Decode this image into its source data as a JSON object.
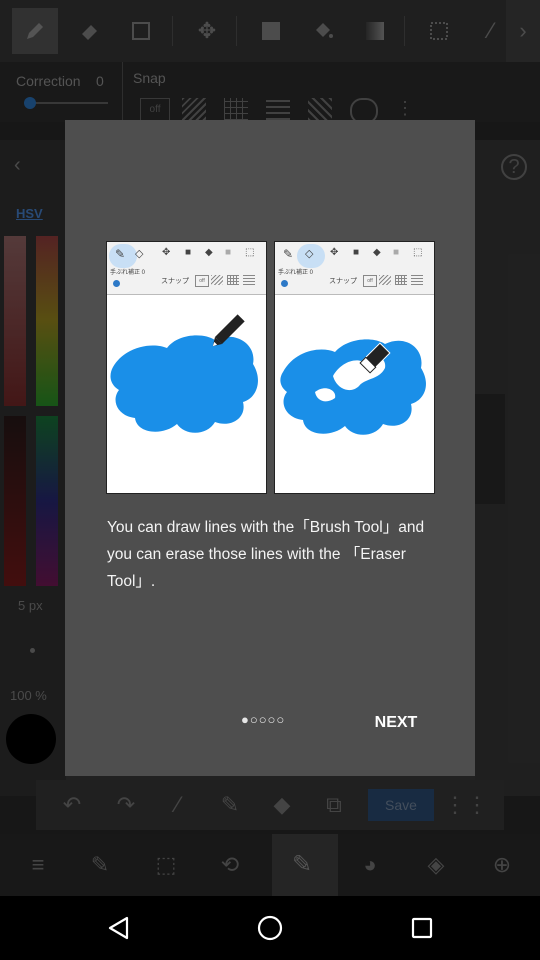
{
  "toolbar": {
    "icons": [
      "pen-icon",
      "eraser-icon",
      "selection-icon",
      "move-icon",
      "fill-rect-icon",
      "bucket-icon",
      "gradient-icon",
      "dotted-select-icon",
      "magic-wand-icon",
      "chevron-right-icon"
    ]
  },
  "subbar": {
    "correction_label": "Correction",
    "correction_value": "0",
    "snap_label": "Snap",
    "snap_off": "off"
  },
  "left_panel": {
    "back_icon": "chevron-left-icon",
    "hsv_label": "HSV",
    "size_label": "5 px",
    "opacity_label": "100 %"
  },
  "right_panel": {
    "help_icon": "question-icon"
  },
  "bottom_bar": {
    "save_label": "Save"
  },
  "dialog": {
    "left_image": {
      "correction": "手ぶれ補正 0",
      "snap": "スナップ",
      "snap_off": "off"
    },
    "right_image": {
      "correction": "手ぶれ補正 0",
      "snap": "スナップ",
      "snap_off": "off"
    },
    "description": "You can draw lines with the「Brush Tool」and you can erase those lines with the 「Eraser Tool」.",
    "page_indicator": "●○○○○",
    "page_current": 1,
    "page_total": 5,
    "next_label": "NEXT"
  },
  "colors": {
    "dialog_bg": "#4e4e4e",
    "brush_blue": "#1a8fe8",
    "accent_blue": "#2d79c7"
  }
}
